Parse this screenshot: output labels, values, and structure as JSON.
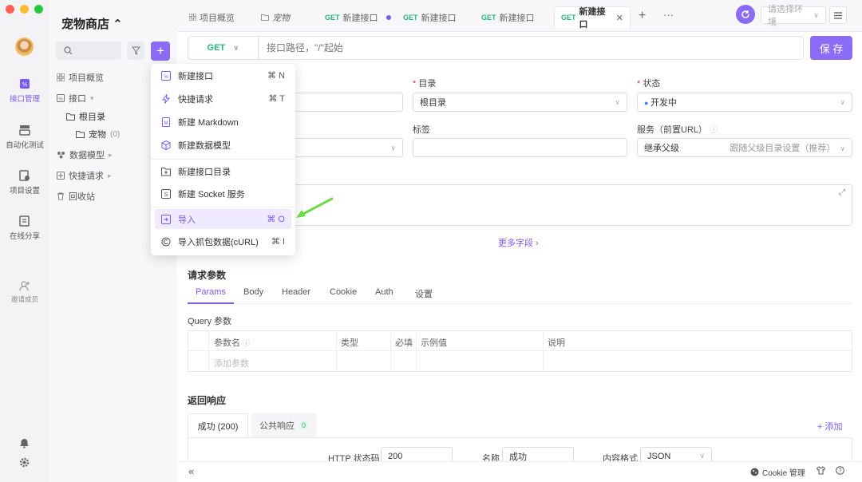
{
  "nav": {
    "items": [
      {
        "label": "接口管理",
        "icon": "api-icon"
      },
      {
        "label": "自动化测试",
        "icon": "test-icon"
      },
      {
        "label": "项目设置",
        "icon": "settings-icon"
      },
      {
        "label": "在线分享",
        "icon": "share-icon"
      },
      {
        "label": "邀请成员",
        "icon": "invite-icon"
      }
    ]
  },
  "project": {
    "name": "宠物商店 ⌃"
  },
  "tree": {
    "overview": "项目概览",
    "api": "接口",
    "root": "根目录",
    "pets": "宠物",
    "pets_count": "(0)",
    "models": "数据模型",
    "quick": "快捷请求",
    "trash": "回收站"
  },
  "tabs": [
    {
      "method": "",
      "label": "项目概览"
    },
    {
      "method": "",
      "label": "宠物"
    },
    {
      "method": "GET",
      "label": "新建接口"
    },
    {
      "method": "GET",
      "label": "新建接口"
    },
    {
      "method": "GET",
      "label": "新建接口"
    },
    {
      "method": "GET",
      "label": "新建接口"
    }
  ],
  "env": {
    "placeholder": "请选择环境"
  },
  "url": {
    "method": "GET",
    "placeholder": "接口路径，\"/\"起始"
  },
  "save_label": "保 存",
  "form": {
    "dir_label": "目录",
    "dir_value": "根目录",
    "status_label": "状态",
    "status_value": "开发中",
    "tags_label": "标签",
    "service_label": "服务（前置URL）",
    "service_value": "继承父级",
    "service_hint": "跟随父级目录设置（推荐）",
    "more_fields": "更多字段 ›"
  },
  "menu": {
    "items": [
      {
        "label": "新建接口",
        "shortcut": "⌘ N",
        "icon": "api-doc-icon"
      },
      {
        "label": "快捷请求",
        "shortcut": "⌘ T",
        "icon": "lightning-icon"
      },
      {
        "label": "新建 Markdown",
        "shortcut": "",
        "icon": "markdown-icon"
      },
      {
        "label": "新建数据模型",
        "shortcut": "",
        "icon": "cube-icon"
      },
      {
        "label": "新建接口目录",
        "shortcut": "",
        "icon": "folder-plus-icon"
      },
      {
        "label": "新建 Socket 服务",
        "shortcut": "",
        "icon": "socket-icon"
      },
      {
        "label": "导入",
        "shortcut": "⌘ O",
        "icon": "import-icon"
      },
      {
        "label": "导入抓包数据(cURL)",
        "shortcut": "⌘ I",
        "icon": "curl-icon"
      }
    ]
  },
  "request": {
    "title": "请求参数",
    "tabs": [
      "Params",
      "Body",
      "Header",
      "Cookie",
      "Auth",
      "设置"
    ],
    "query_title": "Query 参数",
    "columns": [
      "参数名",
      "类型",
      "必填",
      "示例值",
      "说明"
    ],
    "add_param": "添加参数"
  },
  "response": {
    "title": "返回响应",
    "tab_success": "成功 (200)",
    "tab_common": "公共响应",
    "tab_common_count": "0",
    "add": "+ 添加",
    "http_code_label": "HTTP 状态码",
    "http_code_value": "200",
    "name_label": "名称",
    "name_value": "成功",
    "format_label": "内容格式",
    "format_value": "JSON"
  },
  "bottom": {
    "cookie": "Cookie 管理"
  },
  "colors": {
    "accent": "#8b6cf6",
    "get": "#2ab37a",
    "arrow": "#6fd94a"
  }
}
